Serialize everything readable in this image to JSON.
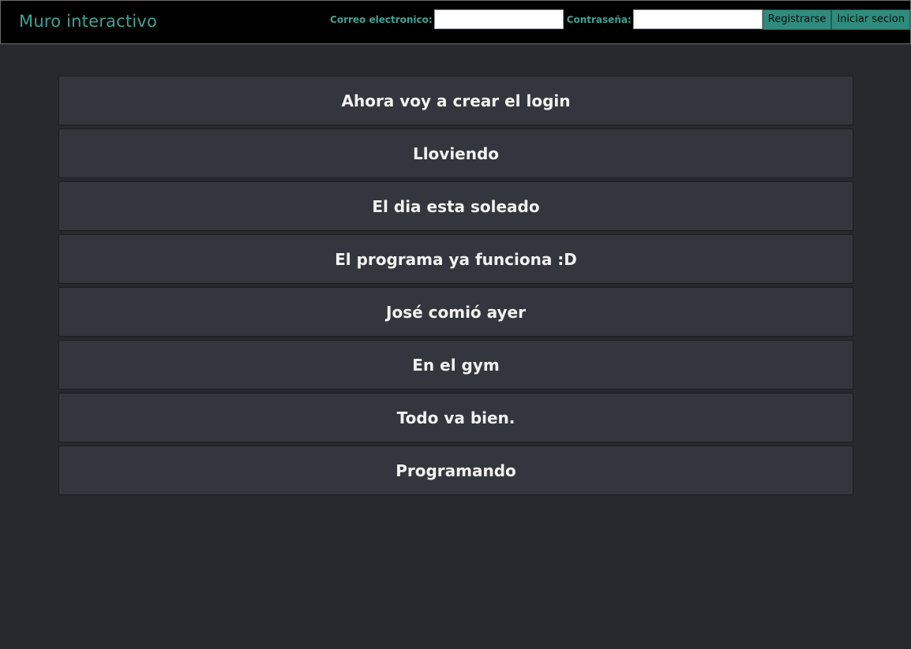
{
  "header": {
    "brand": "Muro interactivo",
    "email_label": "Correo electronico:",
    "email_value": "",
    "password_label": "Contraseña:",
    "password_value": "",
    "register_label": "Registrarse",
    "login_label": "Iniciar secion"
  },
  "colors": {
    "accent": "#3ea394",
    "button_bg": "#2f8c7d",
    "background": "#26292e",
    "card_bg": "#33373d"
  },
  "posts": [
    "Ahora voy a crear el login",
    "Lloviendo",
    "El dia esta soleado",
    "El programa ya funciona :D",
    "José comió ayer",
    "En el gym",
    "Todo va bien.",
    "Programando"
  ]
}
